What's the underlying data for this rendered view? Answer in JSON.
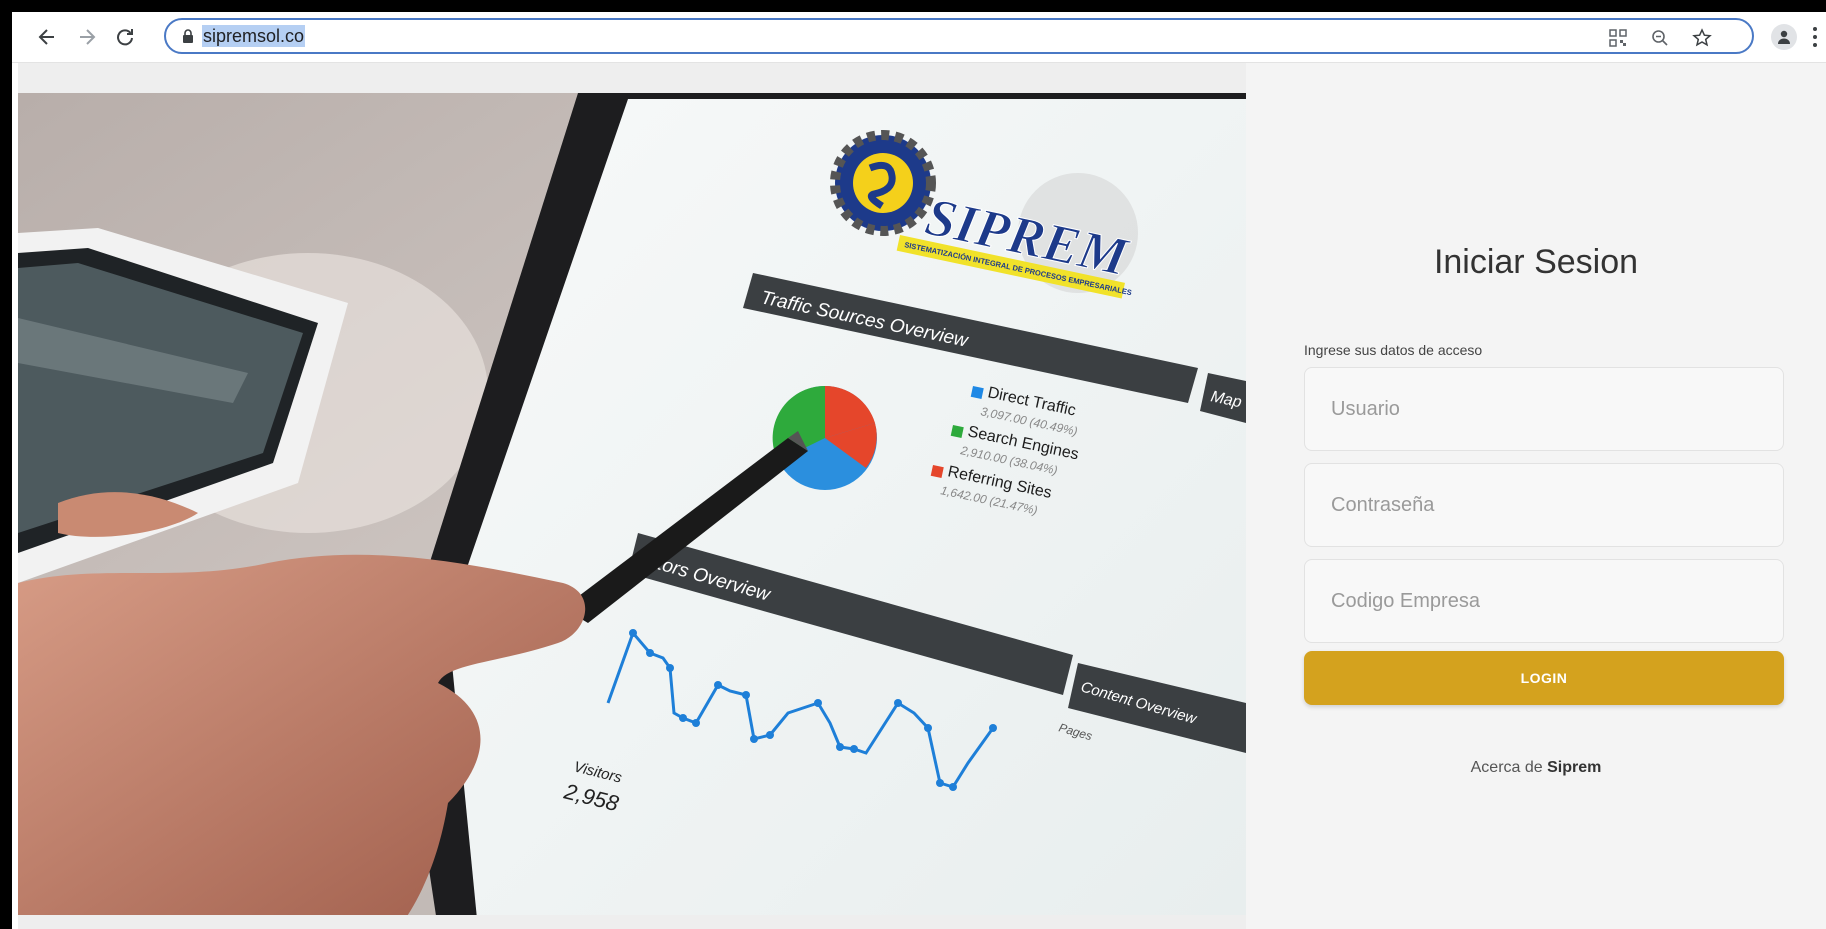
{
  "browser": {
    "url": "sipremsol.co",
    "icons": [
      "back-arrow-icon",
      "forward-arrow-icon",
      "reload-icon",
      "lock-icon",
      "qr-code-icon",
      "zoom-icon",
      "bookmark-star-icon",
      "profile-icon",
      "menu-dots-icon"
    ]
  },
  "hero": {
    "logo_text": "SIPREM",
    "logo_tagline": "SISTEMATIZACIÓN INTEGRAL DE PROCESOS EMPRESARIALES",
    "dashboard": {
      "panel1_title": "Traffic Sources Overview",
      "legend": [
        {
          "label": "Direct Traffic",
          "value": "3,097.00 (40.49%)",
          "color": "#1e88e5"
        },
        {
          "label": "Search Engines",
          "value": "2,910.00 (38.04%)",
          "color": "#2eaa3c"
        },
        {
          "label": "Referring Sites",
          "value": "1,642.00 (21.47%)",
          "color": "#e5462b"
        }
      ],
      "panel2_title": "sitors Overview",
      "visitors_label": "Visitors",
      "visitors_value": "2,958",
      "side_tab": "Map O",
      "content_tab": "Content Overview",
      "pages_label": "Pages"
    }
  },
  "login": {
    "title": "Iniciar Sesion",
    "hint": "Ingrese sus datos de acceso",
    "username_placeholder": "Usuario",
    "password_placeholder": "Contraseña",
    "company_placeholder": "Codigo Empresa",
    "button": "LOGIN",
    "about_prefix": "Acerca de ",
    "about_brand": "Siprem"
  },
  "colors": {
    "accent": "#d4a21e",
    "url_highlight": "#b5cff3",
    "omnibox_border": "#4a79c5"
  }
}
